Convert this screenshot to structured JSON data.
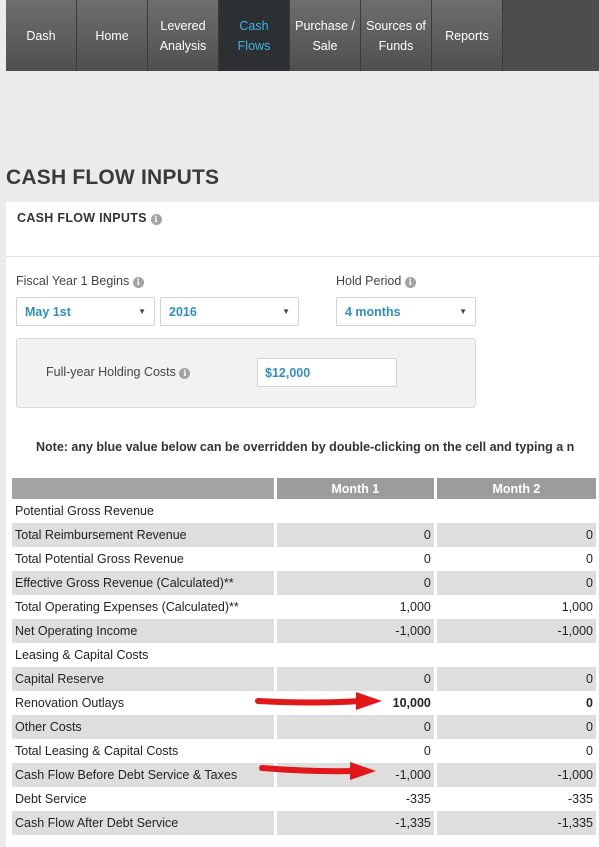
{
  "nav": {
    "items": [
      {
        "label": "Dash",
        "active": false
      },
      {
        "label": "Home",
        "active": false
      },
      {
        "label": "Levered\nAnalysis",
        "active": false
      },
      {
        "label": "Cash\nFlows",
        "active": true
      },
      {
        "label": "Purchase /\nSale",
        "active": false
      },
      {
        "label": "Sources of\nFunds",
        "active": false
      },
      {
        "label": "Reports",
        "active": false
      }
    ]
  },
  "page_title": "CASH FLOW INPUTS",
  "panel": {
    "title": "CASH FLOW INPUTS",
    "fiscal_label": "Fiscal Year 1 Begins",
    "fiscal_month": "May 1st",
    "fiscal_year": "2016",
    "hold_label": "Hold Period",
    "hold_value": "4 months",
    "holding_label": "Full-year Holding Costs",
    "holding_value": "$12,000",
    "note": "Note: any blue value below can be overridden by double-clicking on the cell and typing a n"
  },
  "table": {
    "columns": [
      "",
      "Month 1",
      "Month 2"
    ],
    "rows": [
      {
        "label": "Potential Gross Revenue",
        "m1": "",
        "m2": "",
        "alt": false,
        "blue": false
      },
      {
        "label": "Total Reimbursement Revenue",
        "m1": "0",
        "m2": "0",
        "alt": true,
        "blue": false
      },
      {
        "label": "Total Potential Gross Revenue",
        "m1": "0",
        "m2": "0",
        "alt": false,
        "blue": false
      },
      {
        "label": "Effective Gross Revenue (Calculated)**",
        "m1": "0",
        "m2": "0",
        "alt": true,
        "blue": false
      },
      {
        "label": "Total Operating Expenses (Calculated)**",
        "m1": "1,000",
        "m2": "1,000",
        "alt": false,
        "blue": false
      },
      {
        "label": "Net Operating Income",
        "m1": "-1,000",
        "m2": "-1,000",
        "alt": true,
        "blue": false
      },
      {
        "label": "Leasing & Capital Costs",
        "m1": "",
        "m2": "",
        "alt": false,
        "blue": false
      },
      {
        "label": "Capital Reserve",
        "m1": "0",
        "m2": "0",
        "alt": true,
        "blue": false
      },
      {
        "label": "Renovation Outlays",
        "m1": "10,000",
        "m2": "0",
        "alt": false,
        "blue": true
      },
      {
        "label": "Other Costs",
        "m1": "0",
        "m2": "0",
        "alt": true,
        "blue": false
      },
      {
        "label": "Total Leasing & Capital Costs",
        "m1": "0",
        "m2": "0",
        "alt": false,
        "blue": false
      },
      {
        "label": "Cash Flow Before Debt Service & Taxes",
        "m1": "-1,000",
        "m2": "-1,000",
        "alt": true,
        "blue": false
      },
      {
        "label": "Debt Service",
        "m1": "-335",
        "m2": "-335",
        "alt": false,
        "blue": false
      },
      {
        "label": "Cash Flow After Debt Service",
        "m1": "-1,335",
        "m2": "-1,335",
        "alt": true,
        "blue": false
      }
    ]
  },
  "colors": {
    "accent": "#39b6e6",
    "value_blue": "#2f8fc4",
    "arrow_red": "#e0171b"
  }
}
